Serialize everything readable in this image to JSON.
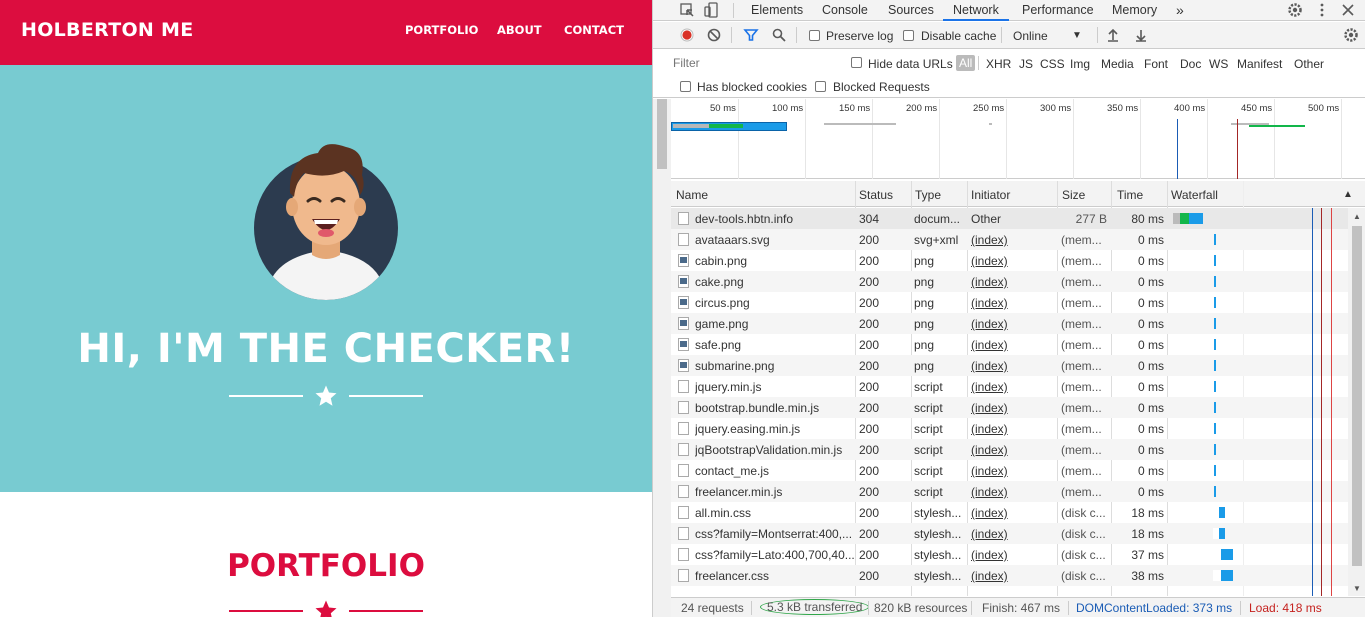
{
  "site": {
    "brand": "HOLBERTON ME",
    "nav": [
      "PORTFOLIO",
      "ABOUT",
      "CONTACT"
    ],
    "hero_title": "HI, I'M THE CHECKER!",
    "portfolio_title": "PORTFOLIO",
    "colors": {
      "primary": "#dc0d3f",
      "hero_bg": "#78cbd1"
    }
  },
  "devtools": {
    "tabs": [
      "Elements",
      "Console",
      "Sources",
      "Network",
      "Performance",
      "Memory"
    ],
    "active_tab": "Network",
    "toolbar": {
      "preserve_log": "Preserve log",
      "disable_cache": "Disable cache",
      "throttling": "Online"
    },
    "filter": {
      "placeholder": "Filter",
      "hide_data_urls": "Hide data URLs",
      "types": [
        "All",
        "XHR",
        "JS",
        "CSS",
        "Img",
        "Media",
        "Font",
        "Doc",
        "WS",
        "Manifest",
        "Other"
      ],
      "has_blocked_cookies": "Has blocked cookies",
      "blocked_requests": "Blocked Requests"
    },
    "overview_ticks": [
      "50 ms",
      "100 ms",
      "150 ms",
      "200 ms",
      "250 ms",
      "300 ms",
      "350 ms",
      "400 ms",
      "450 ms",
      "500 ms"
    ],
    "columns": [
      "Name",
      "Status",
      "Type",
      "Initiator",
      "Size",
      "Time",
      "Waterfall"
    ],
    "requests": [
      {
        "name": "dev-tools.hbtn.info",
        "status": "304",
        "type": "docum...",
        "initiator": "Other",
        "size": "277 B",
        "time": "80 ms",
        "icon": "doc"
      },
      {
        "name": "avataaars.svg",
        "status": "200",
        "type": "svg+xml",
        "initiator": "(index)",
        "size": "(mem...",
        "time": "0 ms",
        "icon": "svg"
      },
      {
        "name": "cabin.png",
        "status": "200",
        "type": "png",
        "initiator": "(index)",
        "size": "(mem...",
        "time": "0 ms",
        "icon": "img"
      },
      {
        "name": "cake.png",
        "status": "200",
        "type": "png",
        "initiator": "(index)",
        "size": "(mem...",
        "time": "0 ms",
        "icon": "img"
      },
      {
        "name": "circus.png",
        "status": "200",
        "type": "png",
        "initiator": "(index)",
        "size": "(mem...",
        "time": "0 ms",
        "icon": "img"
      },
      {
        "name": "game.png",
        "status": "200",
        "type": "png",
        "initiator": "(index)",
        "size": "(mem...",
        "time": "0 ms",
        "icon": "img"
      },
      {
        "name": "safe.png",
        "status": "200",
        "type": "png",
        "initiator": "(index)",
        "size": "(mem...",
        "time": "0 ms",
        "icon": "img"
      },
      {
        "name": "submarine.png",
        "status": "200",
        "type": "png",
        "initiator": "(index)",
        "size": "(mem...",
        "time": "0 ms",
        "icon": "img"
      },
      {
        "name": "jquery.min.js",
        "status": "200",
        "type": "script",
        "initiator": "(index)",
        "size": "(mem...",
        "time": "0 ms",
        "icon": "doc"
      },
      {
        "name": "bootstrap.bundle.min.js",
        "status": "200",
        "type": "script",
        "initiator": "(index)",
        "size": "(mem...",
        "time": "0 ms",
        "icon": "doc"
      },
      {
        "name": "jquery.easing.min.js",
        "status": "200",
        "type": "script",
        "initiator": "(index)",
        "size": "(mem...",
        "time": "0 ms",
        "icon": "doc"
      },
      {
        "name": "jqBootstrapValidation.min.js",
        "status": "200",
        "type": "script",
        "initiator": "(index)",
        "size": "(mem...",
        "time": "0 ms",
        "icon": "doc"
      },
      {
        "name": "contact_me.js",
        "status": "200",
        "type": "script",
        "initiator": "(index)",
        "size": "(mem...",
        "time": "0 ms",
        "icon": "doc"
      },
      {
        "name": "freelancer.min.js",
        "status": "200",
        "type": "script",
        "initiator": "(index)",
        "size": "(mem...",
        "time": "0 ms",
        "icon": "doc"
      },
      {
        "name": "all.min.css",
        "status": "200",
        "type": "stylesh...",
        "initiator": "(index)",
        "size": "(disk c...",
        "time": "18 ms",
        "icon": "doc"
      },
      {
        "name": "css?family=Montserrat:400,...",
        "status": "200",
        "type": "stylesh...",
        "initiator": "(index)",
        "size": "(disk c...",
        "time": "18 ms",
        "icon": "doc"
      },
      {
        "name": "css?family=Lato:400,700,40...",
        "status": "200",
        "type": "stylesh...",
        "initiator": "(index)",
        "size": "(disk c...",
        "time": "37 ms",
        "icon": "doc"
      },
      {
        "name": "freelancer.css",
        "status": "200",
        "type": "stylesh...",
        "initiator": "(index)",
        "size": "(disk c...",
        "time": "38 ms",
        "icon": "doc"
      }
    ],
    "status_bar": {
      "requests": "24 requests",
      "transferred": "5.3 kB transferred",
      "resources": "820 kB resources",
      "finish": "Finish: 467 ms",
      "dcl": "DOMContentLoaded: 373 ms",
      "load": "Load: 418 ms"
    }
  }
}
